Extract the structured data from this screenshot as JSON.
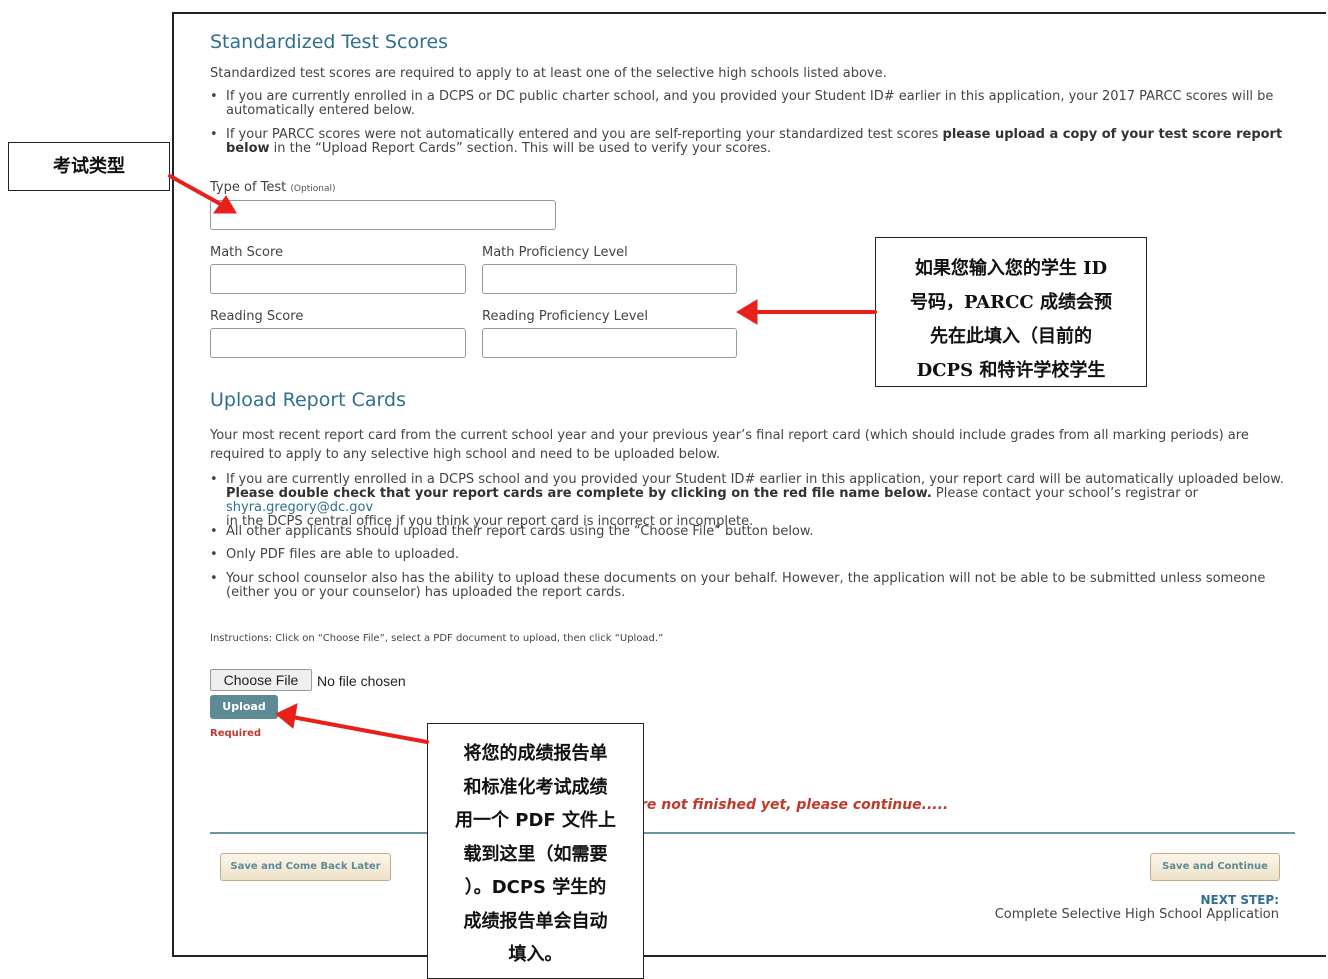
{
  "standardized": {
    "title": "Standardized Test Scores",
    "intro": "Standardized test scores are required to apply to at least one of the selective high schools listed above.",
    "bullets": [
      "If you are currently enrolled in a DCPS or DC public charter school, and you provided your Student ID# earlier in this application, your 2017 PARCC scores will be automatically entered below.",
      {
        "pre": "If your PARCC scores were not automatically entered and you are self-reporting your standardized test scores ",
        "bold": "please upload a copy of your test score report below",
        "post": " in the “Upload Report Cards” section. This will be used to verify your scores."
      }
    ],
    "type_label": "Type of Test",
    "type_optional": "(Optional)",
    "math_score_label": "Math Score",
    "math_prof_label": "Math Proficiency Level",
    "reading_score_label": "Reading Score",
    "reading_prof_label": "Reading Proficiency Level"
  },
  "upload": {
    "title": "Upload Report Cards",
    "intro": "Your most recent report card from the current school year and your previous year’s final report card (which should include grades from all marking periods) are required to apply to any selective high school and need to be uploaded below.",
    "bullet1_pre": "If you are currently enrolled in a DCPS school and you provided your Student ID# earlier in this application, your report card will be automatically uploaded below.",
    "bullet1_bold": "Please double check that your report cards are complete by clicking on the red file name below.",
    "bullet1_mid": " Please contact your school’s registrar or ",
    "bullet1_email": "shyra.gregory@dc.gov",
    "bullet1_post": "in the DCPS central office if you think your report card is incorrect or incomplete.",
    "bullet2": "All other applicants should upload their report cards using the “Choose File” button below.",
    "bullet3": "Only PDF files are able to uploaded.",
    "bullet4": "Your school counselor also has the ability to upload these documents on your behalf. However, the application will not be able to be submitted unless someone (either you or your counselor) has uploaded the report cards.",
    "instructions": "Instructions: Click on “Choose File”, select a PDF document to upload, then click “Upload.”",
    "choose_file": "Choose File",
    "no_file": "No file chosen",
    "upload_btn": "Upload",
    "required": "Required"
  },
  "footer": {
    "not_finished": "re not finished yet, please continue.....",
    "save_later": "Save and Come Back Later",
    "save_continue": "Save and Continue",
    "next_label": "NEXT STEP:",
    "next_text": "Complete Selective High School Application"
  },
  "annotations": {
    "test_type": "考试类型",
    "student_id": [
      "如果您输入您的学生 ID",
      "号码，PARCC 成绩会预",
      "先在此填入（目前的",
      "DCPS 和特许学校学生"
    ],
    "upload_note": [
      "将您的成绩报告单",
      "和标准化考试成绩",
      "用一个 PDF 文件上",
      "载到这里（如需要",
      "）。DCPS 学生的",
      "成绩报告单会自动",
      "填入。"
    ]
  },
  "colors": {
    "accent": "#2f6f8f",
    "upload_button": "#5e8a96",
    "required": "#c0392b",
    "arrow": "#e8201a"
  }
}
